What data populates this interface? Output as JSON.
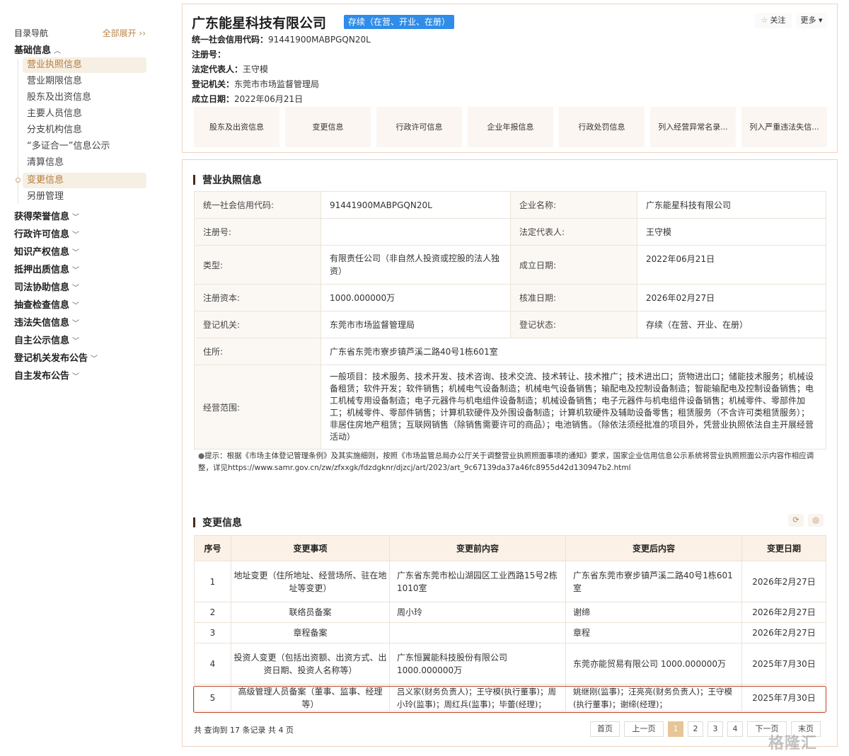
{
  "sidebar": {
    "title": "目录导航",
    "expand_all": "全部展开",
    "expand_icon": "double-chevron-down",
    "groups": [
      {
        "label": "基础信息",
        "expanded": true
      },
      {
        "label": "获得荣誉信息"
      },
      {
        "label": "行政许可信息"
      },
      {
        "label": "知识产权信息"
      },
      {
        "label": "抵押出质信息"
      },
      {
        "label": "司法协助信息"
      },
      {
        "label": "抽查检查信息"
      },
      {
        "label": "违法失信信息"
      },
      {
        "label": "自主公示信息"
      },
      {
        "label": "登记机关发布公告"
      },
      {
        "label": "自主发布公告"
      }
    ],
    "sub_items": [
      {
        "label": "营业执照信息",
        "active": true
      },
      {
        "label": "营业期限信息"
      },
      {
        "label": "股东及出资信息"
      },
      {
        "label": "主要人员信息"
      },
      {
        "label": "分支机构信息"
      },
      {
        "label": "“多证合一”信息公示"
      },
      {
        "label": "清算信息"
      },
      {
        "label": "变更信息",
        "active": true
      },
      {
        "label": "另册管理"
      }
    ]
  },
  "header": {
    "company_name": "广东能星科技有限公司",
    "status": "存续（在营、开业、在册）",
    "status_color": "#2f8ce8",
    "follow_label": "关注",
    "more_label": "更多",
    "lines": [
      {
        "label": "统一社会信用代码：",
        "value": "91441900MABPGQN20L"
      },
      {
        "label": "注册号：",
        "value": ""
      },
      {
        "label": "法定代表人：",
        "value": "王守模"
      },
      {
        "label": "登记机关：",
        "value": "东莞市市场监督管理局"
      },
      {
        "label": "成立日期：",
        "value": "2022年06月21日"
      }
    ],
    "tabs": [
      "股东及出资信息",
      "变更信息",
      "行政许可信息",
      "企业年报信息",
      "行政处罚信息",
      "列入经营异常名录...",
      "列入严重违法失信..."
    ]
  },
  "license": {
    "title": "营业执照信息",
    "credit_code_label": "统一社会信用代码:",
    "credit_code": "91441900MABPGQN20L",
    "name_label": "企业名称:",
    "name": "广东能星科技有限公司",
    "reg_no_label": "注册号:",
    "reg_no": "",
    "legal_rep_label": "法定代表人:",
    "legal_rep": "王守模",
    "type_label": "类型:",
    "type": "有限责任公司（非自然人投资或控股的法人独资）",
    "est_date_label": "成立日期:",
    "est_date": "2022年06月21日",
    "capital_label": "注册资本:",
    "capital": "1000.000000万",
    "approve_date_label": "核准日期:",
    "approve_date": "2026年02月27日",
    "authority_label": "登记机关:",
    "authority": "东莞市市场监督管理局",
    "reg_status_label": "登记状态:",
    "reg_status": "存续（在营、开业、在册）",
    "address_label": "住所:",
    "address": "广东省东莞市寮步镇芦溪二路40号1栋601室",
    "scope_label": "经营范围:",
    "scope": "一般项目：技术服务、技术开发、技术咨询、技术交流、技术转让、技术推广；技术进出口；货物进出口；储能技术服务；机械设备租赁；软件开发；软件销售；机械电气设备制造；机械电气设备销售；输配电及控制设备制造；智能输配电及控制设备销售；电工机械专用设备制造；电子元器件与机电组件设备制造；机械设备销售；电子元器件与机电组件设备销售；机械零件、零部件加工；机械零件、零部件销售；计算机软硬件及外围设备制造；计算机软硬件及辅助设备零售；租赁服务（不含许可类租赁服务）；非居住房地产租赁；互联网销售（除销售需要许可的商品）；电池销售。（除依法须经批准的项目外，凭营业执照依法自主开展经营活动）",
    "tip": "提示：根据《市场主体登记管理条例》及其实施细则，按照《市场监管总局办公厅关于调整营业执照照面事项的通知》要求，国家企业信用信息公示系统将营业执照照面公示内容作相应调整，详见https://www.samr.gov.cn/zw/zfxxgk/fdzdgknr/djzcj/art/2023/art_9c67139da37a46fc8955d42d130947b2.html"
  },
  "changes": {
    "title": "变更信息",
    "headers": [
      "序号",
      "变更事项",
      "变更前内容",
      "变更后内容",
      "变更日期"
    ],
    "rows": [
      {
        "no": "1",
        "item": "地址变更（住所地址、经营场所、驻在地址等变更）",
        "before": "广东省东莞市松山湖园区工业西路15号2栋1010室",
        "after": "广东省东莞市寮步镇芦溪二路40号1栋601室",
        "date": "2026年2月27日"
      },
      {
        "no": "2",
        "item": "联络员备案",
        "before": "周小玲",
        "after": "谢缔",
        "date": "2026年2月27日"
      },
      {
        "no": "3",
        "item": "章程备案",
        "before": "",
        "after": "章程",
        "date": "2026年2月27日"
      },
      {
        "no": "4",
        "item": "投资人变更（包括出资额、出资方式、出资日期、投资人名称等）",
        "before": "广东恒翼能科技股份有限公司 1000.000000万",
        "after": "东莞亦能贸易有限公司 1000.000000万",
        "date": "2025年7月30日"
      },
      {
        "no": "5",
        "item": "高级管理人员备案（董事、监事、经理等）",
        "before": "吕义家(财务负责人)；王守模(执行董事)；周小玲(监事)；周红兵(监事)；毕蕾(经理)；",
        "after": "姚继刚(监事)；汪亮亮(财务负责人)；王守模(执行董事)；谢缔(经理)；",
        "date": "2025年7月30日"
      }
    ],
    "total": "共 查询到 17 条记录 共 4 页",
    "pager": {
      "first": "首页",
      "prev": "上一页",
      "pages": [
        "1",
        "2",
        "3",
        "4"
      ],
      "current": "1",
      "next": "下一页",
      "last": "末页"
    },
    "highlight_color": "#c0432b"
  },
  "watermark": "格隆汇"
}
